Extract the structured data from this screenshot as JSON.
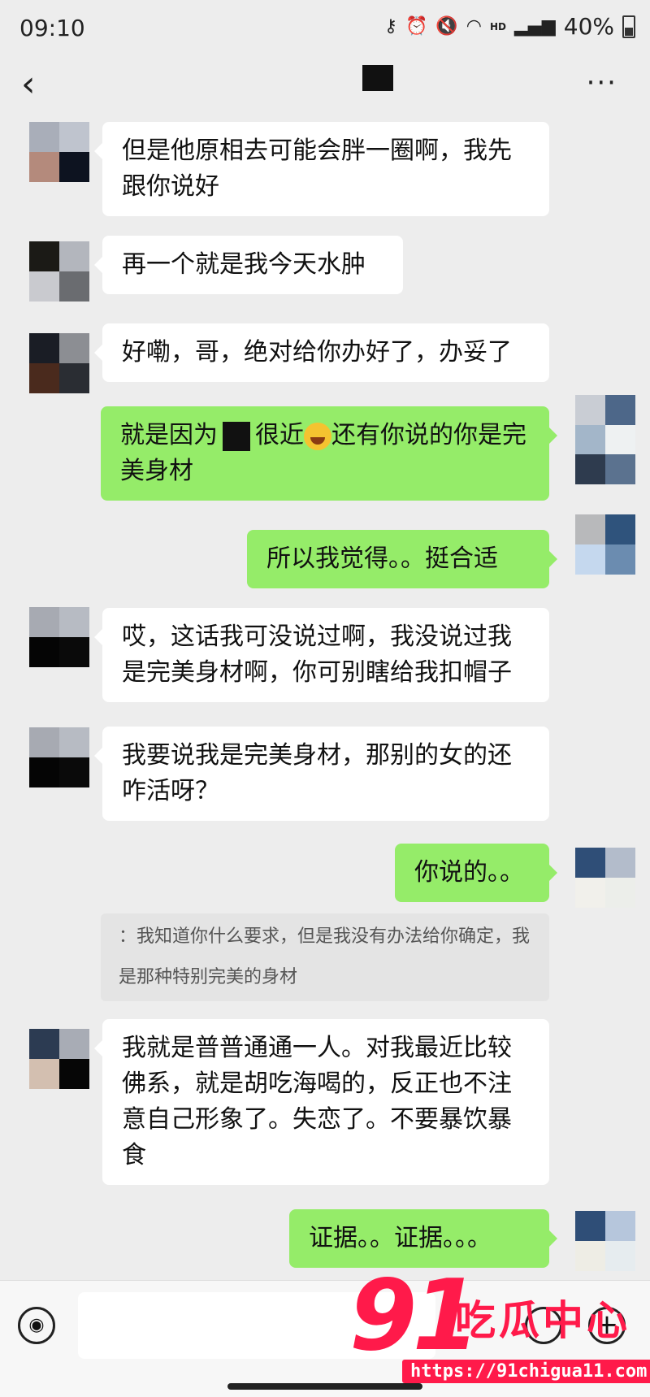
{
  "status": {
    "time": "09:10",
    "hd": "HD",
    "battery": "40%"
  },
  "nav": {
    "back": "‹",
    "more": "···"
  },
  "messages": [
    {
      "text": "但是他原相去可能会胖一圈啊，我先跟你说好"
    },
    {
      "text": "再一个就是我今天水肿"
    },
    {
      "text": "好嘞，哥，绝对给你办好了，办妥了"
    },
    {
      "pre": "就是因为",
      "mid": "很近",
      "post": "还有你说的你是完美身材"
    },
    {
      "text": "所以我觉得。。挺合适"
    },
    {
      "text": "哎，这话我可没说过啊，我没说过我是完美身材啊，你可别瞎给我扣帽子"
    },
    {
      "text": "我要说我是完美身材，那别的女的还咋活呀？"
    },
    {
      "text": "你说的。。"
    },
    {
      "quote": "：我知道你什么要求，但是我没有办法给你确定，我是那种特别完美的身材"
    },
    {
      "text": "我就是普普通通一人。对我最近比较佛系，就是胡吃海喝的，反正也不注意自己形象了。失恋了。不要暴饮暴食"
    },
    {
      "text": "证据。。证据。。。"
    }
  ],
  "watermark": {
    "logo": "91",
    "name": "吃瓜中心",
    "url": "https://91chigua11.com"
  }
}
